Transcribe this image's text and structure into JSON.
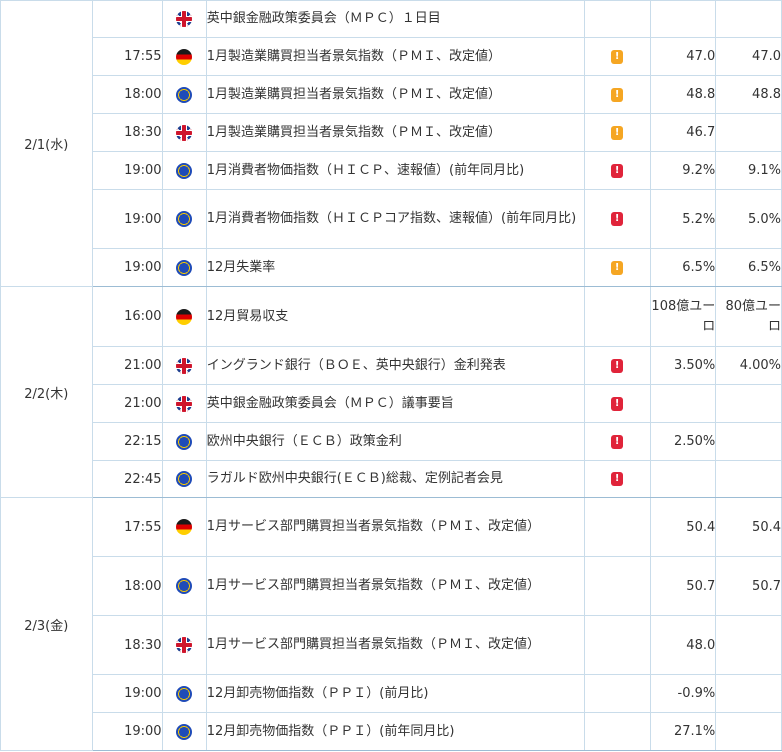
{
  "colors": {
    "border": "#c9dcea",
    "importance_mid": "#f5a623",
    "importance_high": "#e0243a"
  },
  "groups": [
    {
      "date": "2/1(水)",
      "rows": [
        {
          "time": "",
          "flag": "uk-flag-icon",
          "event": "英中銀金融政策委員会（ＭＰＣ）１日目",
          "importance": "",
          "prev": "",
          "forecast": "",
          "h": 37
        },
        {
          "time": "17:55",
          "flag": "germany-flag-icon",
          "event": "1月製造業購買担当者景気指数（ＰＭＩ、改定値）",
          "importance": "mid",
          "prev": "47.0",
          "forecast": "47.0",
          "h": 38
        },
        {
          "time": "18:00",
          "flag": "eu-flag-icon",
          "event": "1月製造業購買担当者景気指数（ＰＭＩ、改定値）",
          "importance": "mid",
          "prev": "48.8",
          "forecast": "48.8",
          "h": 38
        },
        {
          "time": "18:30",
          "flag": "uk-flag-icon",
          "event": "1月製造業購買担当者景気指数（ＰＭＩ、改定値）",
          "importance": "mid",
          "prev": "46.7",
          "forecast": "",
          "h": 38
        },
        {
          "time": "19:00",
          "flag": "eu-flag-icon",
          "event": "1月消費者物価指数（ＨＩＣＰ、速報値）(前年同月比)",
          "importance": "high",
          "prev": "9.2%",
          "forecast": "9.1%",
          "h": 38
        },
        {
          "time": "19:00",
          "flag": "eu-flag-icon",
          "event": "1月消費者物価指数（ＨＩＣＰコア指数、速報値）(前年同月比)",
          "importance": "high",
          "prev": "5.2%",
          "forecast": "5.0%",
          "h": 59
        },
        {
          "time": "19:00",
          "flag": "eu-flag-icon",
          "event": "12月失業率",
          "importance": "mid",
          "prev": "6.5%",
          "forecast": "6.5%",
          "h": 38
        }
      ]
    },
    {
      "date": "2/2(木)",
      "rows": [
        {
          "time": "16:00",
          "flag": "germany-flag-icon",
          "event": "12月貿易収支",
          "importance": "",
          "prev": "108億ユーロ",
          "forecast": "80億ユーロ",
          "h": 60
        },
        {
          "time": "21:00",
          "flag": "uk-flag-icon",
          "event": "イングランド銀行（ＢＯＥ、英中央銀行）金利発表",
          "importance": "high",
          "prev": "3.50%",
          "forecast": "4.00%",
          "h": 38
        },
        {
          "time": "21:00",
          "flag": "uk-flag-icon",
          "event": "英中銀金融政策委員会（ＭＰＣ）議事要旨",
          "importance": "high",
          "prev": "",
          "forecast": "",
          "h": 38
        },
        {
          "time": "22:15",
          "flag": "eu-flag-icon",
          "event": "欧州中央銀行（ＥＣＢ）政策金利",
          "importance": "high",
          "prev": "2.50%",
          "forecast": "",
          "h": 38
        },
        {
          "time": "22:45",
          "flag": "eu-flag-icon",
          "event": "ラガルド欧州中央銀行(ＥＣＢ)総裁、定例記者会見",
          "importance": "high",
          "prev": "",
          "forecast": "",
          "h": 37
        }
      ]
    },
    {
      "date": "2/3(金)",
      "rows": [
        {
          "time": "17:55",
          "flag": "germany-flag-icon",
          "event": "1月サービス部門購買担当者景気指数（ＰＭＩ、改定値）",
          "importance": "",
          "prev": "50.4",
          "forecast": "50.4",
          "h": 59
        },
        {
          "time": "18:00",
          "flag": "eu-flag-icon",
          "event": "1月サービス部門購買担当者景気指数（ＰＭＩ、改定値）",
          "importance": "",
          "prev": "50.7",
          "forecast": "50.7",
          "h": 59
        },
        {
          "time": "18:30",
          "flag": "uk-flag-icon",
          "event": "1月サービス部門購買担当者景気指数（ＰＭＩ、改定値）",
          "importance": "",
          "prev": "48.0",
          "forecast": "",
          "h": 59
        },
        {
          "time": "19:00",
          "flag": "eu-flag-icon",
          "event": "12月卸売物価指数（ＰＰＩ）(前月比)",
          "importance": "",
          "prev": "-0.9%",
          "forecast": "",
          "h": 38
        },
        {
          "time": "19:00",
          "flag": "eu-flag-icon",
          "event": "12月卸売物価指数（ＰＰＩ）(前年同月比)",
          "importance": "",
          "prev": "27.1%",
          "forecast": "",
          "h": 38
        }
      ]
    }
  ]
}
